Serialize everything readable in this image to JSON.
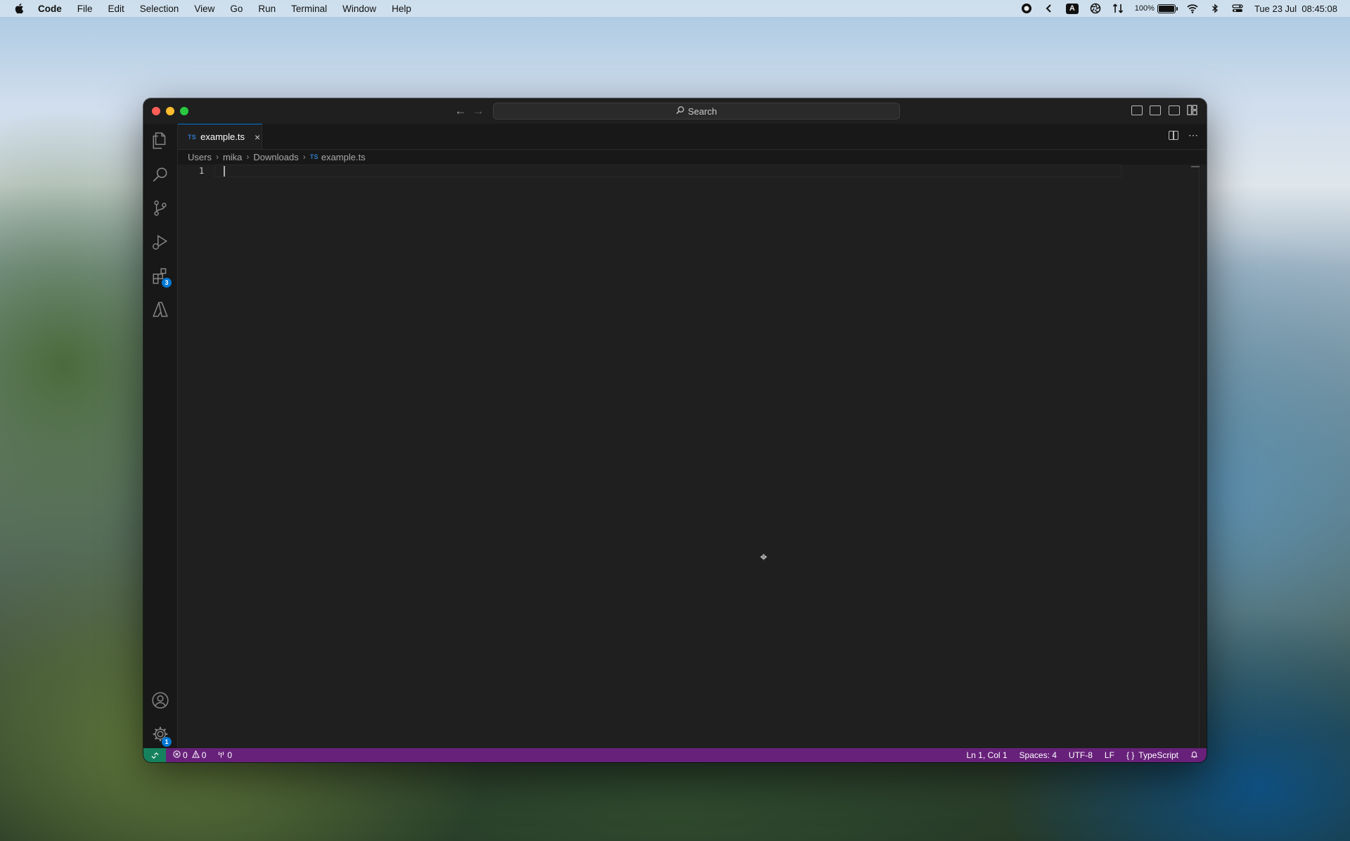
{
  "menubar": {
    "app_name": "Code",
    "menus": [
      "File",
      "Edit",
      "Selection",
      "View",
      "Go",
      "Run",
      "Terminal",
      "Window",
      "Help"
    ],
    "keyboard_layout": "A",
    "battery_percent": "100%",
    "battery_level": 1.0,
    "datetime": "Tue 23 Jul  08:45:08"
  },
  "titlebar": {
    "search_label": "Search"
  },
  "activitybar": {
    "extensions_badge": "3",
    "settings_badge": "1"
  },
  "tabs": [
    {
      "icon_label": "TS",
      "label": "example.ts",
      "close": "×"
    }
  ],
  "breadcrumbs": {
    "items": [
      "Users",
      "mika",
      "Downloads"
    ],
    "file_icon": "TS",
    "file": "example.ts"
  },
  "editor": {
    "line_numbers": [
      "1"
    ],
    "content": ""
  },
  "statusbar": {
    "errors": "0",
    "warnings": "0",
    "ports": "0",
    "cursor_position": "Ln 1, Col 1",
    "indentation": "Spaces: 4",
    "encoding": "UTF-8",
    "eol": "LF",
    "language": "TypeScript"
  },
  "colors": {
    "statusbar_bg": "#68217a",
    "remote_bg": "#16825d",
    "accent": "#0078d4",
    "editor_bg": "#1f1f1f"
  }
}
